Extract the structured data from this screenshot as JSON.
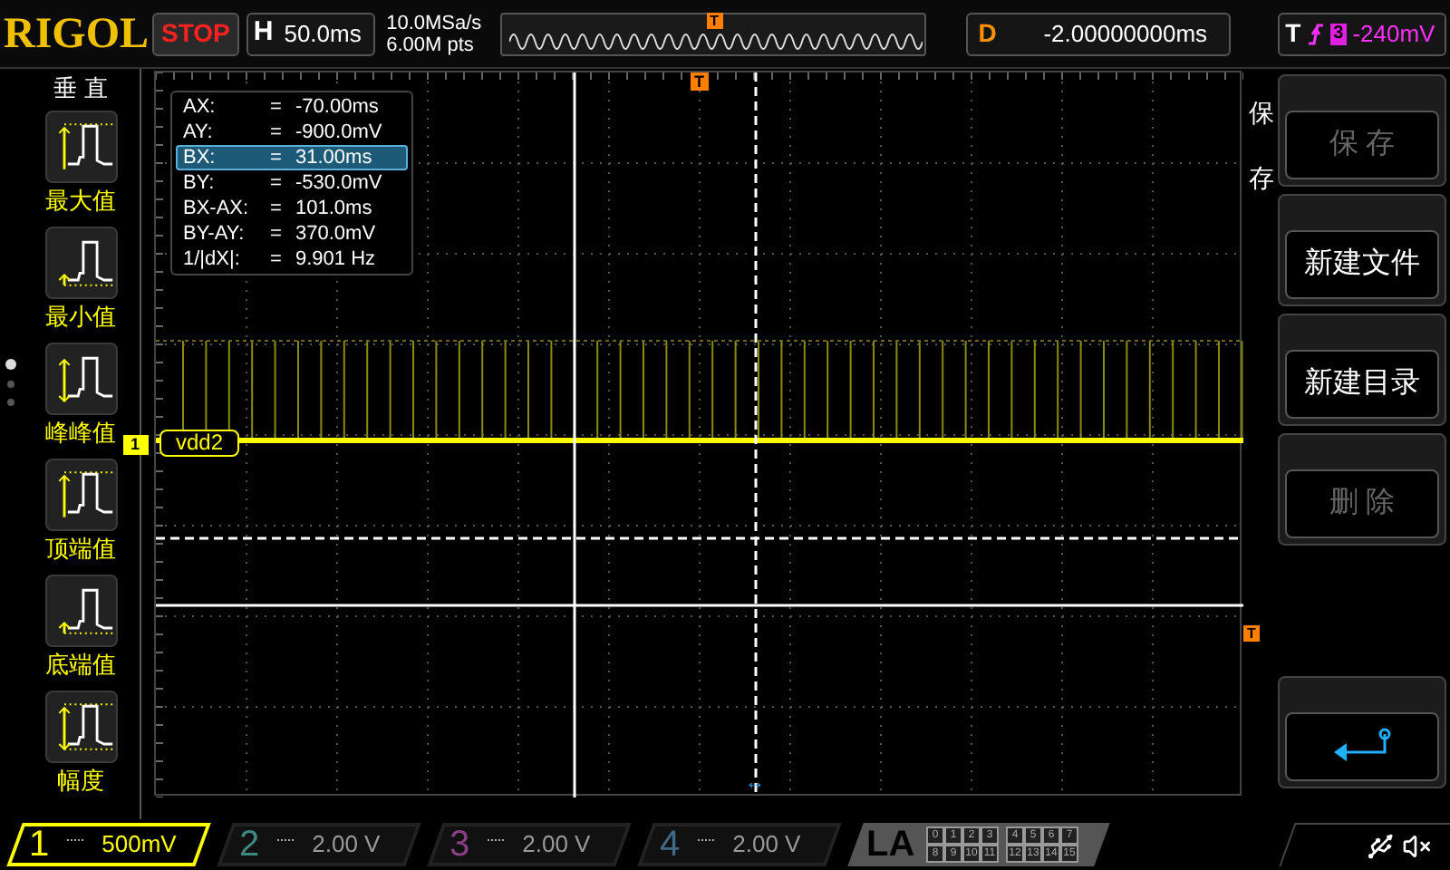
{
  "top_bar": {
    "brand": "RIGOL",
    "run_state": "STOP",
    "timebase": {
      "label": "H",
      "value": "50.0ms"
    },
    "sample_rate": "10.0MSa/s",
    "memory_depth": "6.00M pts",
    "overview_trigger_marker": "T",
    "delay": {
      "label": "D",
      "value": "-2.00000000ms"
    },
    "trigger": {
      "label": "T",
      "source": "3",
      "level": "-240mV"
    }
  },
  "left_menu": {
    "title": "垂 直",
    "page_dots": [
      {
        "selected": true
      },
      {
        "selected": false
      },
      {
        "selected": false
      }
    ],
    "items": [
      {
        "kind": "max",
        "label": "最大值"
      },
      {
        "kind": "min",
        "label": "最小值"
      },
      {
        "kind": "vpp",
        "label": "峰峰值"
      },
      {
        "kind": "top",
        "label": "顶端值"
      },
      {
        "kind": "base",
        "label": "底端值"
      },
      {
        "kind": "amp",
        "label": "幅度"
      }
    ]
  },
  "cursor_readout": [
    {
      "name": "AX:",
      "value": "-70.00ms",
      "selected": false
    },
    {
      "name": "AY:",
      "value": "-900.0mV",
      "selected": false
    },
    {
      "name": "BX:",
      "value": "31.00ms",
      "selected": true
    },
    {
      "name": "BY:",
      "value": "-530.0mV",
      "selected": false
    },
    {
      "name": "BX-AX:",
      "value": "101.0ms",
      "selected": false
    },
    {
      "name": "BY-AY:",
      "value": "370.0mV",
      "selected": false
    },
    {
      "name": "1/|dX|:",
      "value": "9.901 Hz",
      "selected": false
    }
  ],
  "equals_sign": "=",
  "channel_label": {
    "marker": "1",
    "name": "vdd2"
  },
  "trigger_markers": {
    "top": "T",
    "right": "T"
  },
  "cursor_x_marker": "↔",
  "right_menu": {
    "title": "保存",
    "buttons": [
      {
        "kind": "text",
        "label": "保 存",
        "disabled": true
      },
      {
        "kind": "text",
        "label": "新建文件",
        "disabled": false
      },
      {
        "kind": "text",
        "label": "新建目录",
        "disabled": false
      },
      {
        "kind": "text",
        "label": "删 除",
        "disabled": true
      },
      {
        "kind": "back"
      }
    ]
  },
  "channels": [
    {
      "number": "1",
      "scale": "500mV",
      "active": true,
      "color": "#ffff00"
    },
    {
      "number": "2",
      "scale": "2.00 V",
      "active": false,
      "color": "#3f8a80"
    },
    {
      "number": "3",
      "scale": "2.00 V",
      "active": false,
      "color": "#8a3f86"
    },
    {
      "number": "4",
      "scale": "2.00 V",
      "active": false,
      "color": "#3f6a8a"
    }
  ],
  "la": {
    "label": "LA",
    "bits": [
      [
        "0",
        "1",
        "2",
        "3"
      ],
      [
        "4",
        "5",
        "6",
        "7"
      ],
      [
        "8",
        "9",
        "10",
        "11"
      ],
      [
        "12",
        "13",
        "14",
        "15"
      ]
    ]
  }
}
